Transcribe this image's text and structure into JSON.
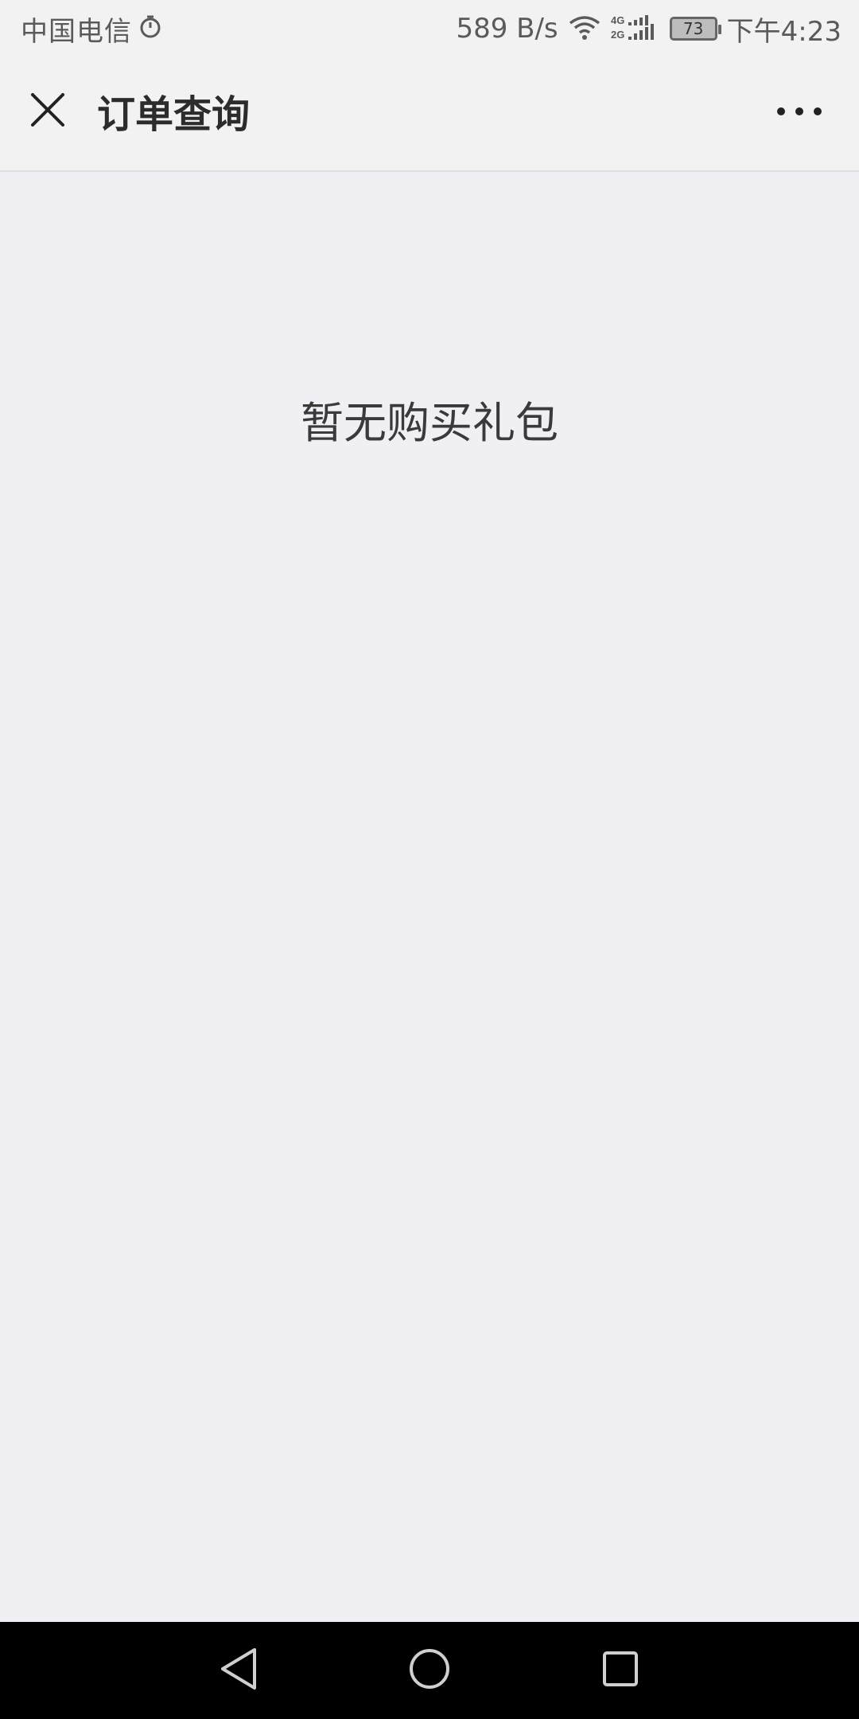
{
  "status_bar": {
    "carrier": "中国电信",
    "network_speed": "589 B/s",
    "battery_level": "73",
    "time": "下午4:23",
    "icons": [
      "alarm-clock-icon",
      "wifi-icon",
      "signal-4g-2g-icon",
      "battery-icon"
    ]
  },
  "title_bar": {
    "title": "订单查询",
    "close_icon": "close-icon",
    "more_icon": "more-dots-icon"
  },
  "content": {
    "empty_message": "暂无购买礼包"
  },
  "nav_bar": {
    "icons": [
      "back-triangle-icon",
      "home-circle-icon",
      "recent-square-icon"
    ]
  },
  "colors": {
    "background": "#F0F0F4",
    "header_background": "#F2F2F2",
    "title_text": "#2c2c2c",
    "status_text": "#5a5a5a",
    "nav_background": "#000000"
  }
}
